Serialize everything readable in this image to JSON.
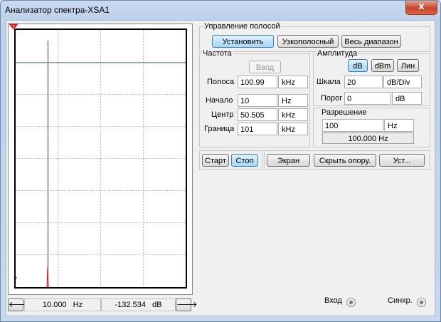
{
  "window": {
    "title": "Анализатор спектра-XSA1",
    "close_label": "x"
  },
  "plot": {
    "marker_label": "1",
    "cursor_frequency": "10.000",
    "cursor_frequency_unit": "Hz",
    "cursor_level": "-132.534",
    "cursor_level_unit": "dB",
    "left_arrow": "🡐",
    "right_arrow": "🡒"
  },
  "band_control": {
    "title": "Управление полосой",
    "set_label": "Установить",
    "narrow_label": "Узкополосный",
    "full_label": "Весь диапазон"
  },
  "frequency": {
    "title": "Частота",
    "enter_label": "Ввод",
    "rows": [
      {
        "label": "Полоса",
        "value": "100.99",
        "unit": "kHz"
      },
      {
        "label": "Начало",
        "value": "10",
        "unit": "Hz"
      },
      {
        "label": "Центр",
        "value": "50.505",
        "unit": "kHz"
      },
      {
        "label": "Граница",
        "value": "101",
        "unit": "kHz"
      }
    ]
  },
  "amplitude": {
    "title": "Амплитуда",
    "modes": [
      "dB",
      "dBm",
      "Лин"
    ],
    "active_mode": "dB",
    "scale_label": "Шкала",
    "scale_value": "20",
    "scale_unit": "dB/Div",
    "threshold_label": "Порог",
    "threshold_value": "0",
    "threshold_unit": "dB"
  },
  "resolution": {
    "title": "Разрешение",
    "value": "100",
    "unit": "Hz",
    "readout": "100.000  Hz"
  },
  "controls": {
    "start_label": "Старт",
    "stop_label": "Стоп",
    "screen_label": "Экран",
    "hide_ref_label": "Скрыть опору.",
    "settings_label": "Уст..."
  },
  "terminals": {
    "input_label": "Вход",
    "sync_label": "Синхр."
  }
}
